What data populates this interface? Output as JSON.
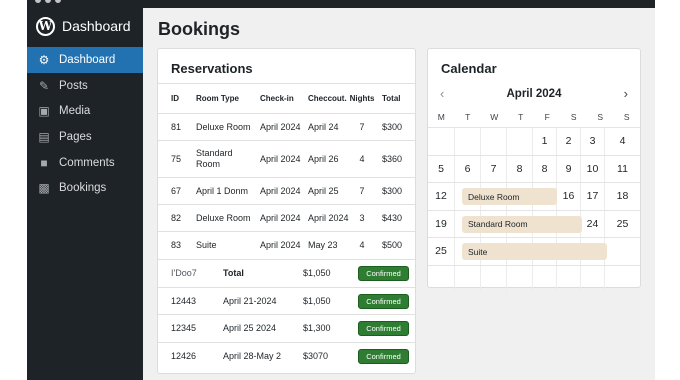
{
  "sidebar": {
    "brand": "Dashboard",
    "items": [
      {
        "label": "Dashboard",
        "icon": "gear-icon"
      },
      {
        "label": "Posts",
        "icon": "pin-icon"
      },
      {
        "label": "Media",
        "icon": "media-icon"
      },
      {
        "label": "Pages",
        "icon": "pages-icon"
      },
      {
        "label": "Comments",
        "icon": "comment-icon"
      },
      {
        "label": "Bookings",
        "icon": "bookings-icon"
      }
    ]
  },
  "page": {
    "title": "Bookings"
  },
  "reservations": {
    "title": "Reservations",
    "headers": [
      "ID",
      "Room Type",
      "Check-in",
      "Checcout.",
      "Nights",
      "Total"
    ],
    "rows": [
      [
        "81",
        "Deluxe Room",
        "April 2024",
        "April 24",
        "7",
        "$300"
      ],
      [
        "75",
        "Standard Room",
        "April 2024",
        "April 26",
        "4",
        "$360"
      ],
      [
        "67",
        "April 1 Donm",
        "April 2024",
        "April 25",
        "7",
        "$300"
      ],
      [
        "82",
        "Deluxe Room",
        "April 2024",
        "April 2024",
        "3",
        "$430"
      ],
      [
        "83",
        "Suite",
        "April 2024",
        "May 23",
        "4",
        "$500"
      ]
    ]
  },
  "summary": {
    "header": {
      "id": "I'Doo7",
      "label": "Total",
      "amount": "$1,050",
      "status": "Confirmed"
    },
    "rows": [
      {
        "id": "12443",
        "dates": "April 21-2024",
        "amount": "$1,050",
        "status": "Confirmed"
      },
      {
        "id": "12345",
        "dates": "April 25 2024",
        "amount": "$1,300",
        "status": "Confirmed"
      },
      {
        "id": "12426",
        "dates": "April 28-May 2",
        "amount": "$3070",
        "status": "Confirmed"
      }
    ]
  },
  "calendar": {
    "title": "Calendar",
    "month": "April 2024",
    "prev": "‹",
    "next": "›",
    "dow": [
      "M",
      "T",
      "W",
      "T",
      "F",
      "S",
      "S",
      "S"
    ],
    "weeks": [
      [
        "",
        "",
        "",
        "",
        "1",
        "2",
        "3",
        "4"
      ],
      [
        "5",
        "6",
        "7",
        "8",
        "8",
        "9",
        "10",
        "11"
      ],
      [
        "12",
        "",
        "",
        "",
        "",
        "16",
        "17",
        "18"
      ],
      [
        "19",
        "",
        "",
        "",
        "",
        "",
        "24",
        "25"
      ],
      [
        "25",
        "",
        "",
        "",
        "",
        "",
        "",
        ""
      ],
      [
        "",
        "",
        "",
        "",
        "",
        "",
        "",
        ""
      ]
    ],
    "events": [
      {
        "label": "Deluxe Room",
        "week": 2
      },
      {
        "label": "Standard Room",
        "week": 3
      },
      {
        "label": "Suite",
        "week": 4
      }
    ]
  },
  "colors": {
    "accent": "#2271b1",
    "sidebar": "#1d2327",
    "confirmed": "#2e7d32",
    "event": "#efe3d0"
  }
}
